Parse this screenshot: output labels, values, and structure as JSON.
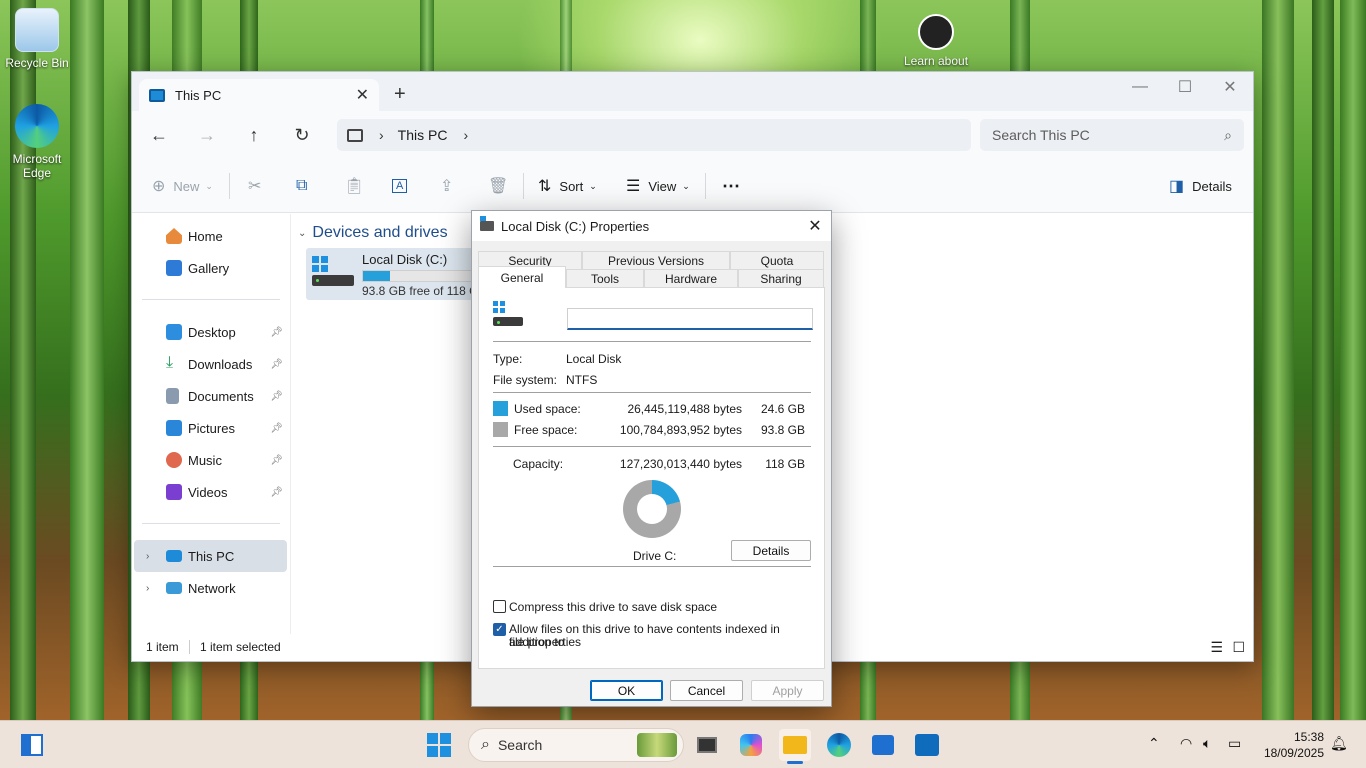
{
  "desktop": {
    "icons": [
      {
        "label": "Recycle Bin"
      },
      {
        "label": "Microsoft Edge"
      },
      {
        "label": "Learn about"
      }
    ]
  },
  "explorer": {
    "tab_title": "This PC",
    "breadcrumb": [
      "This PC"
    ],
    "search_placeholder": "Search This PC",
    "toolbar": {
      "new_label": "New",
      "sort_label": "Sort",
      "view_label": "View",
      "details_label": "Details"
    },
    "sidebar": {
      "quick": [
        {
          "label": "Home",
          "icon": "home-icon"
        },
        {
          "label": "Gallery",
          "icon": "gallery-icon"
        }
      ],
      "pinned": [
        {
          "label": "Desktop",
          "icon": "desktop-folder-icon"
        },
        {
          "label": "Downloads",
          "icon": "downloads-folder-icon"
        },
        {
          "label": "Documents",
          "icon": "documents-folder-icon"
        },
        {
          "label": "Pictures",
          "icon": "pictures-folder-icon"
        },
        {
          "label": "Music",
          "icon": "music-folder-icon"
        },
        {
          "label": "Videos",
          "icon": "videos-folder-icon"
        }
      ],
      "locations": [
        {
          "label": "This PC",
          "icon": "monitor-icon",
          "selected": true
        },
        {
          "label": "Network",
          "icon": "network-icon"
        }
      ]
    },
    "group_header": "Devices and drives",
    "drive": {
      "name": "Local Disk (C:)",
      "free_text": "93.8 GB free of 118 GB",
      "used_fraction": 0.208
    },
    "status": {
      "items": "1 item",
      "selected": "1 item selected"
    }
  },
  "dialog": {
    "title": "Local Disk (C:) Properties",
    "tabs_row1": [
      "Security",
      "Previous Versions",
      "Quota"
    ],
    "tabs_row2": [
      "General",
      "Tools",
      "Hardware",
      "Sharing"
    ],
    "active_tab": "General",
    "volume_label_value": "",
    "type_label": "Type:",
    "type_value": "Local Disk",
    "fs_label": "File system:",
    "fs_value": "NTFS",
    "used_label": "Used space:",
    "used_bytes": "26,445,119,488 bytes",
    "used_gb": "24.6 GB",
    "free_label": "Free space:",
    "free_bytes": "100,784,893,952 bytes",
    "free_gb": "93.8 GB",
    "capacity_label": "Capacity:",
    "capacity_bytes": "127,230,013,440 bytes",
    "capacity_gb": "118 GB",
    "drive_label": "Drive C:",
    "details_button": "Details",
    "compress_label": "Compress this drive to save disk space",
    "compress_checked": false,
    "index_label_line1": "Allow files on this drive to have contents indexed in addition to",
    "index_label_line2": "file properties",
    "index_checked": true,
    "ok_label": "OK",
    "cancel_label": "Cancel",
    "apply_label": "Apply",
    "colors": {
      "used": "#26a0da",
      "free": "#a8a8a8"
    }
  },
  "taskbar": {
    "search_label": "Search",
    "time": "15:38",
    "date": "18/09/2025"
  }
}
